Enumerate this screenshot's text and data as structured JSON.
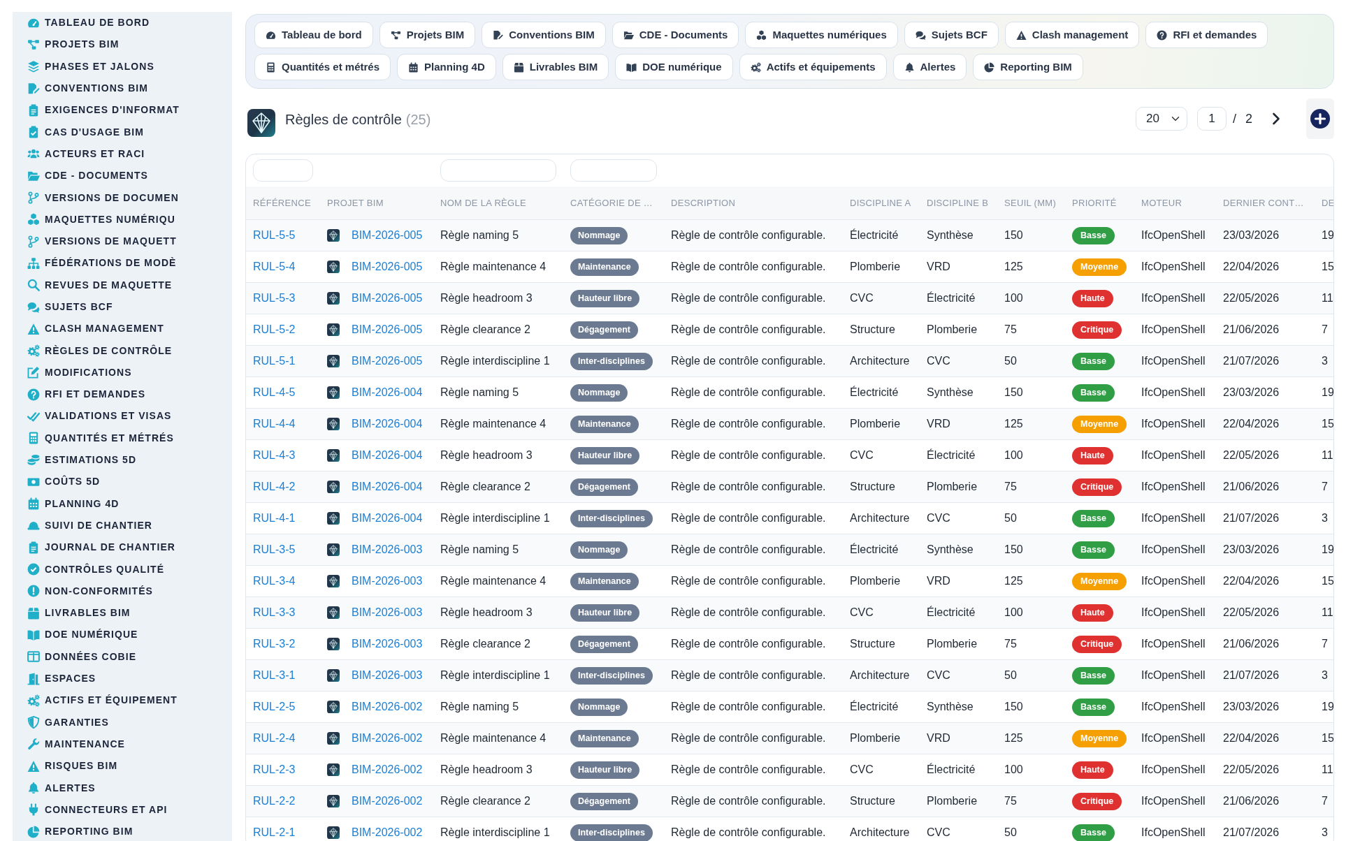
{
  "sidebar": {
    "items": [
      "TABLEAU DE BORD",
      "PROJETS BIM",
      "PHASES ET JALONS",
      "CONVENTIONS BIM",
      "EXIGENCES D'INFORMAT",
      "CAS D'USAGE BIM",
      "ACTEURS ET RACI",
      "CDE - DOCUMENTS",
      "VERSIONS DE DOCUMEN",
      "MAQUETTES NUMÉRIQU",
      "VERSIONS DE MAQUETT",
      "FÉDÉRATIONS DE MODÈ",
      "REVUES DE MAQUETTE",
      "SUJETS BCF",
      "CLASH MANAGEMENT",
      "RÈGLES DE CONTRÔLE",
      "MODIFICATIONS",
      "RFI ET DEMANDES",
      "VALIDATIONS ET VISAS",
      "QUANTITÉS ET MÉTRÉS",
      "ESTIMATIONS 5D",
      "COÛTS 5D",
      "PLANNING 4D",
      "SUIVI DE CHANTIER",
      "JOURNAL DE CHANTIER",
      "CONTRÔLES QUALITÉ",
      "NON-CONFORMITÉS",
      "LIVRABLES BIM",
      "DOE NUMÉRIQUE",
      "DONNÉES COBIE",
      "ESPACES",
      "ACTIFS ET ÉQUIPEMENT",
      "GARANTIES",
      "MAINTENANCE",
      "RISQUES BIM",
      "ALERTES",
      "CONNECTEURS ET API",
      "REPORTING BIM"
    ]
  },
  "top_nav": {
    "buttons": [
      "Tableau de bord",
      "Projets BIM",
      "Conventions BIM",
      "CDE - Documents",
      "Maquettes numériques",
      "Sujets BCF",
      "Clash management",
      "RFI et demandes",
      "Quantités et métrés",
      "Planning 4D",
      "Livrables BIM",
      "DOE numérique",
      "Actifs et équipements",
      "Alertes",
      "Reporting BIM"
    ]
  },
  "header": {
    "title": "Règles de contrôle",
    "count": "(25)"
  },
  "pagination": {
    "page_size": "20",
    "page": "1",
    "separator": "/",
    "total_pages": "2"
  },
  "table": {
    "columns": [
      {
        "label": "RÉFÉRENCE",
        "filter": true
      },
      {
        "label": "PROJET BIM",
        "filter": false
      },
      {
        "label": "NOM DE LA RÈGLE",
        "filter": true
      },
      {
        "label": "CATÉGORIE DE …",
        "filter": true
      },
      {
        "label": "DESCRIPTION",
        "filter": false
      },
      {
        "label": "DISCIPLINE A",
        "filter": false
      },
      {
        "label": "DISCIPLINE B",
        "filter": false
      },
      {
        "label": "SEUIL (MM)",
        "filter": false
      },
      {
        "label": "PRIORITÉ",
        "filter": false
      },
      {
        "label": "MOTEUR",
        "filter": false
      },
      {
        "label": "DERNIER CONT…",
        "filter": false
      },
      {
        "label": "DE",
        "filter": false
      }
    ],
    "rows": [
      {
        "reference": "RUL-5-5",
        "project": "BIM-2026-005",
        "name": "Règle naming 5",
        "category": "Nommage",
        "description": "Règle de contrôle configurable.",
        "discipline_a": "Électricité",
        "discipline_b": "Synthèse",
        "threshold": "150",
        "priority": {
          "label": "Basse",
          "color": "#2f9e44"
        },
        "engine": "IfcOpenShell",
        "last_check": "23/03/2026",
        "column_12": "19"
      },
      {
        "reference": "RUL-5-4",
        "project": "BIM-2026-005",
        "name": "Règle maintenance 4",
        "category": "Maintenance",
        "description": "Règle de contrôle configurable.",
        "discipline_a": "Plomberie",
        "discipline_b": "VRD",
        "threshold": "125",
        "priority": {
          "label": "Moyenne",
          "color": "#f59f00"
        },
        "engine": "IfcOpenShell",
        "last_check": "22/04/2026",
        "column_12": "15"
      },
      {
        "reference": "RUL-5-3",
        "project": "BIM-2026-005",
        "name": "Règle headroom 3",
        "category": "Hauteur libre",
        "description": "Règle de contrôle configurable.",
        "discipline_a": "CVC",
        "discipline_b": "Électricité",
        "threshold": "100",
        "priority": {
          "label": "Haute",
          "color": "#e03131"
        },
        "engine": "IfcOpenShell",
        "last_check": "22/05/2026",
        "column_12": "11"
      },
      {
        "reference": "RUL-5-2",
        "project": "BIM-2026-005",
        "name": "Règle clearance 2",
        "category": "Dégagement",
        "description": "Règle de contrôle configurable.",
        "discipline_a": "Structure",
        "discipline_b": "Plomberie",
        "threshold": "75",
        "priority": {
          "label": "Critique",
          "color": "#e03131"
        },
        "engine": "IfcOpenShell",
        "last_check": "21/06/2026",
        "column_12": "7"
      },
      {
        "reference": "RUL-5-1",
        "project": "BIM-2026-005",
        "name": "Règle interdiscipline 1",
        "category": "Inter-disciplines",
        "description": "Règle de contrôle configurable.",
        "discipline_a": "Architecture",
        "discipline_b": "CVC",
        "threshold": "50",
        "priority": {
          "label": "Basse",
          "color": "#2f9e44"
        },
        "engine": "IfcOpenShell",
        "last_check": "21/07/2026",
        "column_12": "3"
      },
      {
        "reference": "RUL-4-5",
        "project": "BIM-2026-004",
        "name": "Règle naming 5",
        "category": "Nommage",
        "description": "Règle de contrôle configurable.",
        "discipline_a": "Électricité",
        "discipline_b": "Synthèse",
        "threshold": "150",
        "priority": {
          "label": "Basse",
          "color": "#2f9e44"
        },
        "engine": "IfcOpenShell",
        "last_check": "23/03/2026",
        "column_12": "19"
      },
      {
        "reference": "RUL-4-4",
        "project": "BIM-2026-004",
        "name": "Règle maintenance 4",
        "category": "Maintenance",
        "description": "Règle de contrôle configurable.",
        "discipline_a": "Plomberie",
        "discipline_b": "VRD",
        "threshold": "125",
        "priority": {
          "label": "Moyenne",
          "color": "#f59f00"
        },
        "engine": "IfcOpenShell",
        "last_check": "22/04/2026",
        "column_12": "15"
      },
      {
        "reference": "RUL-4-3",
        "project": "BIM-2026-004",
        "name": "Règle headroom 3",
        "category": "Hauteur libre",
        "description": "Règle de contrôle configurable.",
        "discipline_a": "CVC",
        "discipline_b": "Électricité",
        "threshold": "100",
        "priority": {
          "label": "Haute",
          "color": "#e03131"
        },
        "engine": "IfcOpenShell",
        "last_check": "22/05/2026",
        "column_12": "11"
      },
      {
        "reference": "RUL-4-2",
        "project": "BIM-2026-004",
        "name": "Règle clearance 2",
        "category": "Dégagement",
        "description": "Règle de contrôle configurable.",
        "discipline_a": "Structure",
        "discipline_b": "Plomberie",
        "threshold": "75",
        "priority": {
          "label": "Critique",
          "color": "#e03131"
        },
        "engine": "IfcOpenShell",
        "last_check": "21/06/2026",
        "column_12": "7"
      },
      {
        "reference": "RUL-4-1",
        "project": "BIM-2026-004",
        "name": "Règle interdiscipline 1",
        "category": "Inter-disciplines",
        "description": "Règle de contrôle configurable.",
        "discipline_a": "Architecture",
        "discipline_b": "CVC",
        "threshold": "50",
        "priority": {
          "label": "Basse",
          "color": "#2f9e44"
        },
        "engine": "IfcOpenShell",
        "last_check": "21/07/2026",
        "column_12": "3"
      },
      {
        "reference": "RUL-3-5",
        "project": "BIM-2026-003",
        "name": "Règle naming 5",
        "category": "Nommage",
        "description": "Règle de contrôle configurable.",
        "discipline_a": "Électricité",
        "discipline_b": "Synthèse",
        "threshold": "150",
        "priority": {
          "label": "Basse",
          "color": "#2f9e44"
        },
        "engine": "IfcOpenShell",
        "last_check": "23/03/2026",
        "column_12": "19"
      },
      {
        "reference": "RUL-3-4",
        "project": "BIM-2026-003",
        "name": "Règle maintenance 4",
        "category": "Maintenance",
        "description": "Règle de contrôle configurable.",
        "discipline_a": "Plomberie",
        "discipline_b": "VRD",
        "threshold": "125",
        "priority": {
          "label": "Moyenne",
          "color": "#f59f00"
        },
        "engine": "IfcOpenShell",
        "last_check": "22/04/2026",
        "column_12": "15"
      },
      {
        "reference": "RUL-3-3",
        "project": "BIM-2026-003",
        "name": "Règle headroom 3",
        "category": "Hauteur libre",
        "description": "Règle de contrôle configurable.",
        "discipline_a": "CVC",
        "discipline_b": "Électricité",
        "threshold": "100",
        "priority": {
          "label": "Haute",
          "color": "#e03131"
        },
        "engine": "IfcOpenShell",
        "last_check": "22/05/2026",
        "column_12": "11"
      },
      {
        "reference": "RUL-3-2",
        "project": "BIM-2026-003",
        "name": "Règle clearance 2",
        "category": "Dégagement",
        "description": "Règle de contrôle configurable.",
        "discipline_a": "Structure",
        "discipline_b": "Plomberie",
        "threshold": "75",
        "priority": {
          "label": "Critique",
          "color": "#e03131"
        },
        "engine": "IfcOpenShell",
        "last_check": "21/06/2026",
        "column_12": "7"
      },
      {
        "reference": "RUL-3-1",
        "project": "BIM-2026-003",
        "name": "Règle interdiscipline 1",
        "category": "Inter-disciplines",
        "description": "Règle de contrôle configurable.",
        "discipline_a": "Architecture",
        "discipline_b": "CVC",
        "threshold": "50",
        "priority": {
          "label": "Basse",
          "color": "#2f9e44"
        },
        "engine": "IfcOpenShell",
        "last_check": "21/07/2026",
        "column_12": "3"
      },
      {
        "reference": "RUL-2-5",
        "project": "BIM-2026-002",
        "name": "Règle naming 5",
        "category": "Nommage",
        "description": "Règle de contrôle configurable.",
        "discipline_a": "Électricité",
        "discipline_b": "Synthèse",
        "threshold": "150",
        "priority": {
          "label": "Basse",
          "color": "#2f9e44"
        },
        "engine": "IfcOpenShell",
        "last_check": "23/03/2026",
        "column_12": "19"
      },
      {
        "reference": "RUL-2-4",
        "project": "BIM-2026-002",
        "name": "Règle maintenance 4",
        "category": "Maintenance",
        "description": "Règle de contrôle configurable.",
        "discipline_a": "Plomberie",
        "discipline_b": "VRD",
        "threshold": "125",
        "priority": {
          "label": "Moyenne",
          "color": "#f59f00"
        },
        "engine": "IfcOpenShell",
        "last_check": "22/04/2026",
        "column_12": "15"
      },
      {
        "reference": "RUL-2-3",
        "project": "BIM-2026-002",
        "name": "Règle headroom 3",
        "category": "Hauteur libre",
        "description": "Règle de contrôle configurable.",
        "discipline_a": "CVC",
        "discipline_b": "Électricité",
        "threshold": "100",
        "priority": {
          "label": "Haute",
          "color": "#e03131"
        },
        "engine": "IfcOpenShell",
        "last_check": "22/05/2026",
        "column_12": "11"
      },
      {
        "reference": "RUL-2-2",
        "project": "BIM-2026-002",
        "name": "Règle clearance 2",
        "category": "Dégagement",
        "description": "Règle de contrôle configurable.",
        "discipline_a": "Structure",
        "discipline_b": "Plomberie",
        "threshold": "75",
        "priority": {
          "label": "Critique",
          "color": "#e03131"
        },
        "engine": "IfcOpenShell",
        "last_check": "21/06/2026",
        "column_12": "7"
      },
      {
        "reference": "RUL-2-1",
        "project": "BIM-2026-002",
        "name": "Règle interdiscipline 1",
        "category": "Inter-disciplines",
        "description": "Règle de contrôle configurable.",
        "discipline_a": "Architecture",
        "discipline_b": "CVC",
        "threshold": "50",
        "priority": {
          "label": "Basse",
          "color": "#2f9e44"
        },
        "engine": "IfcOpenShell",
        "last_check": "21/07/2026",
        "column_12": "3"
      }
    ]
  }
}
